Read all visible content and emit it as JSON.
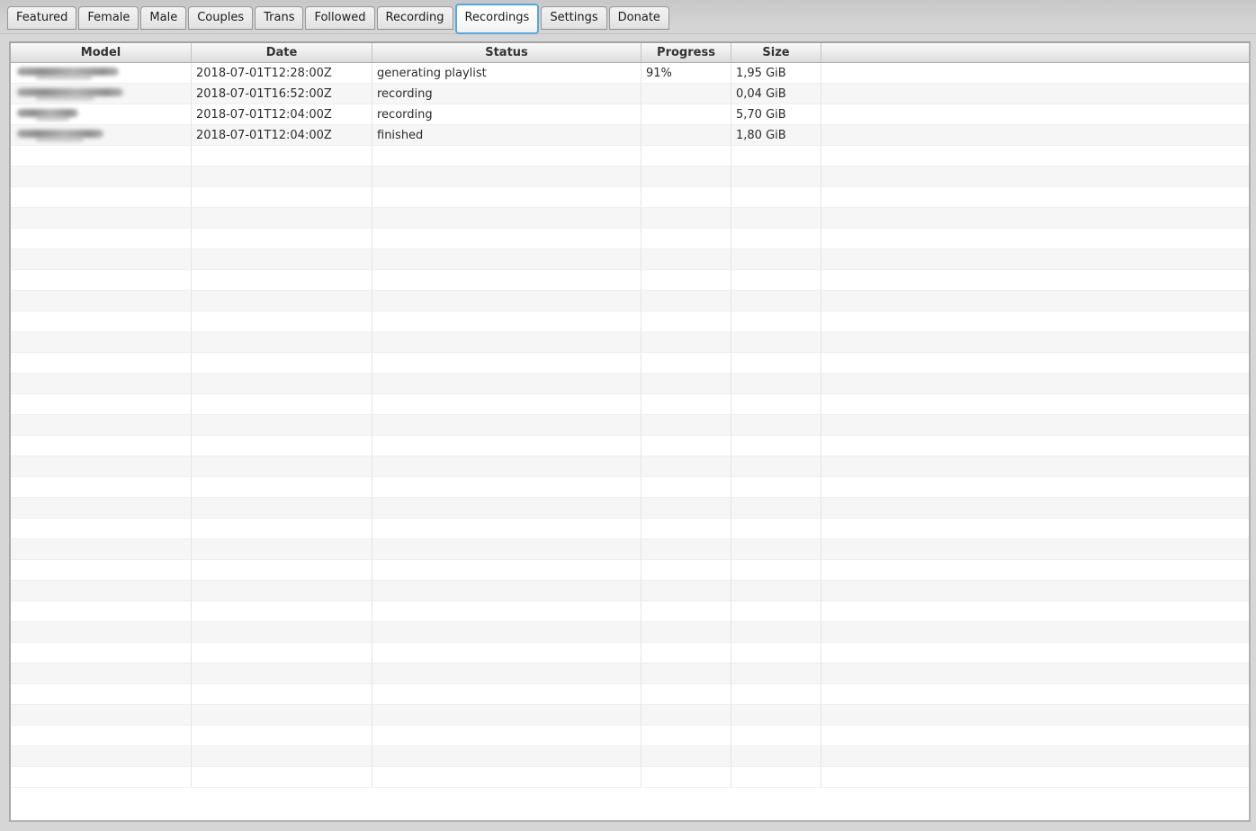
{
  "tabs": {
    "items": [
      {
        "label": "Featured",
        "active": false
      },
      {
        "label": "Female",
        "active": false
      },
      {
        "label": "Male",
        "active": false
      },
      {
        "label": "Couples",
        "active": false
      },
      {
        "label": "Trans",
        "active": false
      },
      {
        "label": "Followed",
        "active": false
      },
      {
        "label": "Recording",
        "active": false
      },
      {
        "label": "Recordings",
        "active": true
      },
      {
        "label": "Settings",
        "active": false
      },
      {
        "label": "Donate",
        "active": false
      }
    ]
  },
  "table": {
    "columns": [
      "Model",
      "Date",
      "Status",
      "Progress",
      "Size"
    ],
    "rows": [
      {
        "model_redacted": true,
        "name_blur_width": 113,
        "date": "2018-07-01T12:28:00Z",
        "status": "generating playlist",
        "progress": "91%",
        "size": "1,95 GiB"
      },
      {
        "model_redacted": true,
        "name_blur_width": 118,
        "date": "2018-07-01T16:52:00Z",
        "status": "recording",
        "progress": "",
        "size": "0,04 GiB"
      },
      {
        "model_redacted": true,
        "name_blur_width": 68,
        "date": "2018-07-01T12:04:00Z",
        "status": "recording",
        "progress": "",
        "size": "5,70 GiB"
      },
      {
        "model_redacted": true,
        "name_blur_width": 96,
        "date": "2018-07-01T12:04:00Z",
        "status": "finished",
        "progress": "",
        "size": "1,80 GiB"
      }
    ],
    "empty_row_count": 31
  },
  "colors": {
    "active_tab_outline": "#58a6d8",
    "window_background": "#d6d6d6",
    "row_stripe": "#f6f6f6",
    "header_text": "#333333"
  }
}
